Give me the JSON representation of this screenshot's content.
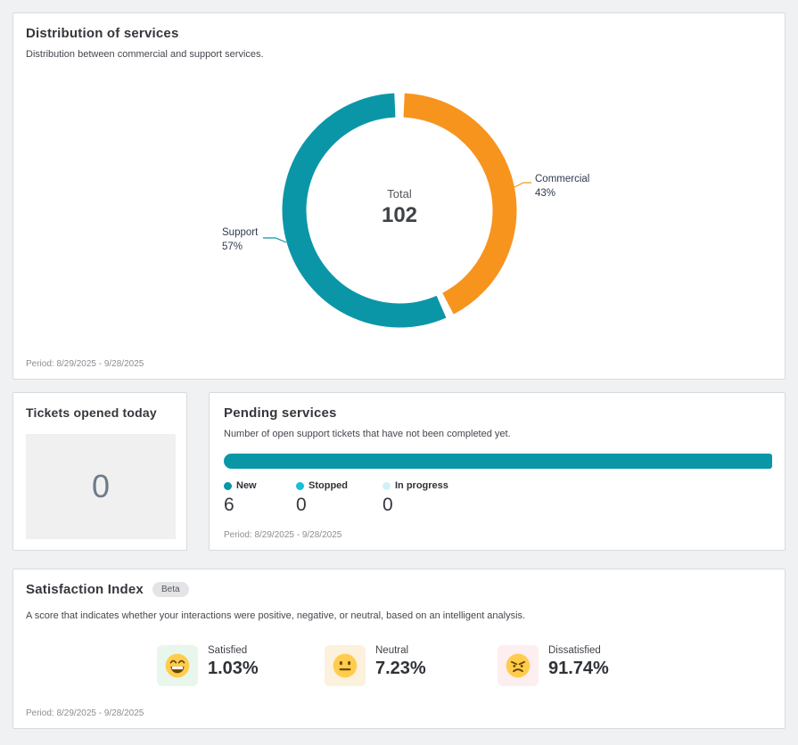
{
  "page": {
    "background": "#f0f1f3",
    "card_border": "#d8dadd"
  },
  "cards": {
    "distribution": {
      "title": "Distribution of services",
      "subtitle": "Distribution between commercial and support services.",
      "period": "Period: 8/29/2025 - 9/28/2025",
      "center": {
        "label": "Total",
        "value": "102"
      },
      "labels": {
        "commercial": {
          "name": "Commercial",
          "pct": "43%"
        },
        "support": {
          "name": "Support",
          "pct": "57%"
        }
      }
    },
    "tickets": {
      "title": "Tickets opened today",
      "value": "0"
    },
    "pending": {
      "title": "Pending services",
      "subtitle": "Number of open support tickets that have not been completed yet.",
      "period": "Period: 8/29/2025 - 9/28/2025",
      "bar_color": "#0b96a8",
      "legend": [
        {
          "label": "New",
          "value": "6",
          "color": "#0b96a8"
        },
        {
          "label": "Stopped",
          "value": "0",
          "color": "#1cbcd6"
        },
        {
          "label": "In progress",
          "value": "0",
          "color": "#d3f0f7"
        }
      ]
    },
    "satisfaction": {
      "title": "Satisfaction Index",
      "badge": "Beta",
      "subtitle": "A score that indicates whether your interactions were positive, negative, or neutral, based on an intelligent analysis.",
      "period": "Period: 8/29/2025 - 9/28/2025",
      "items": [
        {
          "label": "Satisfied",
          "value": "1.03%",
          "icon": "grinning-face-emoji",
          "bg": "#e9f6eb"
        },
        {
          "label": "Neutral",
          "value": "7.23%",
          "icon": "neutral-face-emoji",
          "bg": "#fbf1dc"
        },
        {
          "label": "Dissatisfied",
          "value": "91.74%",
          "icon": "angry-face-emoji",
          "bg": "#fdeef0"
        }
      ]
    }
  },
  "chart_data": [
    {
      "type": "pie",
      "title": "Distribution of services",
      "labels": [
        "Commercial",
        "Support"
      ],
      "values": [
        43,
        57
      ],
      "unit": "%",
      "center_label": "Total",
      "center_value": 102,
      "colors": [
        "#f7941e",
        "#0b96a8"
      ],
      "donut": true,
      "legend_position": "outside-labels"
    },
    {
      "type": "bar",
      "title": "Pending services",
      "orientation": "horizontal-stacked",
      "categories": [
        "New",
        "Stopped",
        "In progress"
      ],
      "values": [
        6,
        0,
        0
      ],
      "colors": [
        "#0b96a8",
        "#1cbcd6",
        "#d3f0f7"
      ],
      "xlim": [
        0,
        6
      ]
    }
  ]
}
